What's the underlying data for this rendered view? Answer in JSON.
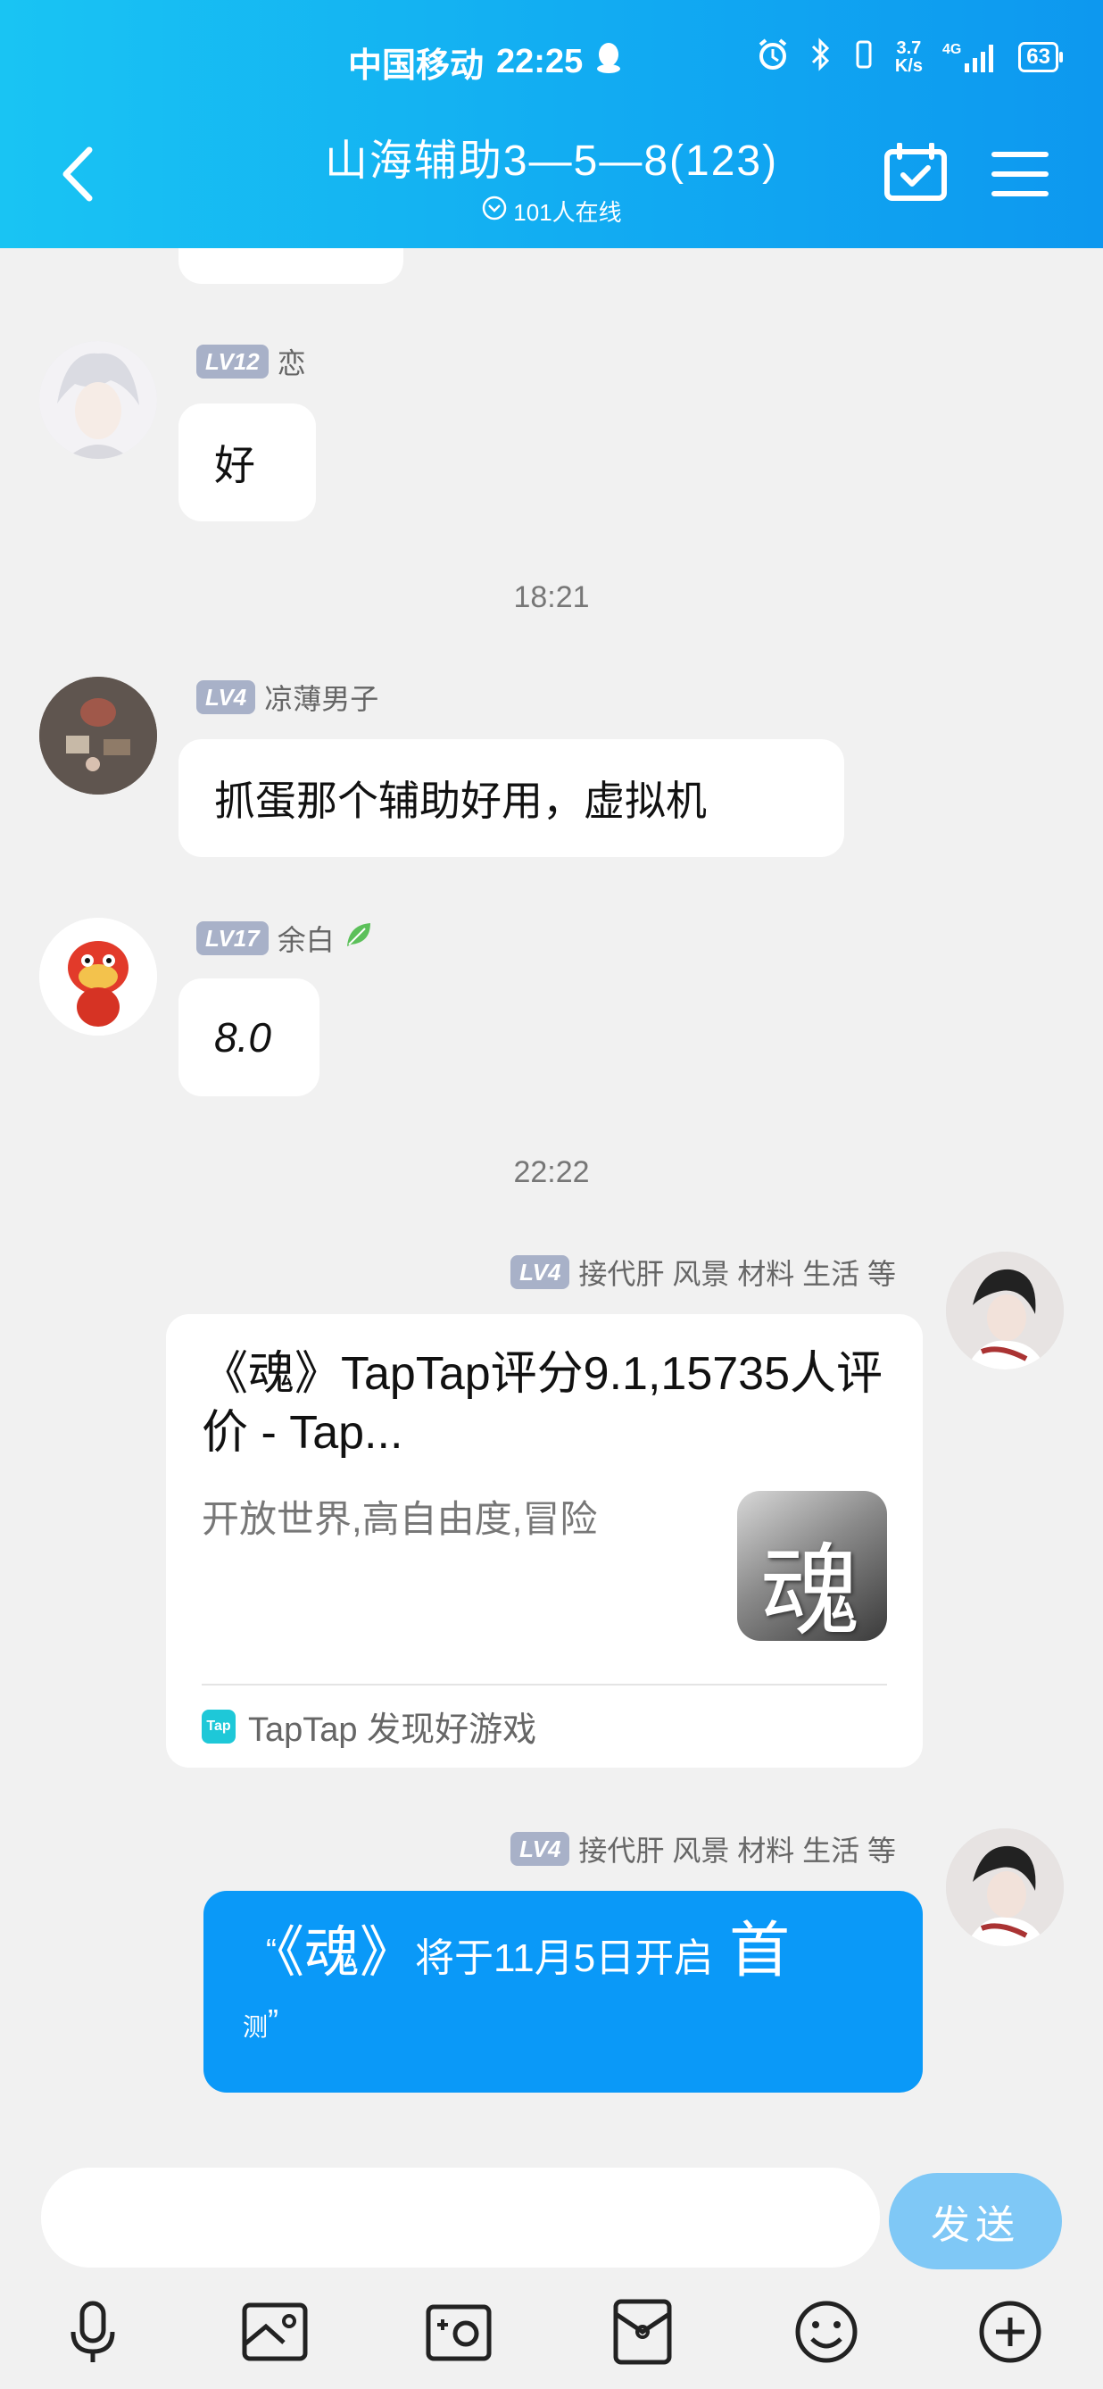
{
  "status_bar": {
    "carrier": "中国移动",
    "time": "22:25",
    "speed_top": "3.7",
    "speed_bottom": "K/s",
    "network": "4G",
    "battery": "63"
  },
  "header": {
    "title": "山海辅助3—5—8(123)",
    "online": "101人在线"
  },
  "messages": [
    {
      "level": "LV12",
      "name": "恋",
      "text": "好"
    },
    {
      "level": "LV4",
      "name": "凉薄男子",
      "text": "抓蛋那个辅助好用，虚拟机"
    },
    {
      "level": "LV17",
      "name": "余白",
      "text": "8.0"
    },
    {
      "level": "LV4",
      "name": "接代肝 风景 材料 生活 等"
    },
    {
      "level": "LV4",
      "name": "接代肝 风景 材料 生活 等"
    }
  ],
  "timestamps": [
    "18:21",
    "22:22"
  ],
  "share_card": {
    "title": "《魂》TapTap评分9.1,15735人评价 - Tap...",
    "description": "开放世界,高自由度,冒险",
    "thumb_char": "魂",
    "source_logo": "Tap",
    "source": "TapTap 发现好游戏"
  },
  "blue_message": {
    "open_quote": "“",
    "big1": "《魂》",
    "mid": "将于11月5日开启",
    "big2": "首",
    "small": "测",
    "close_quote": "”"
  },
  "input": {
    "placeholder": "",
    "send_label": "发送"
  },
  "colors": {
    "header_start": "#19c4f3",
    "header_end": "#0d98ef",
    "blue_bubble": "#0a99f8",
    "send_button": "#7fc8f6",
    "level_badge": "#a8b1c8"
  }
}
